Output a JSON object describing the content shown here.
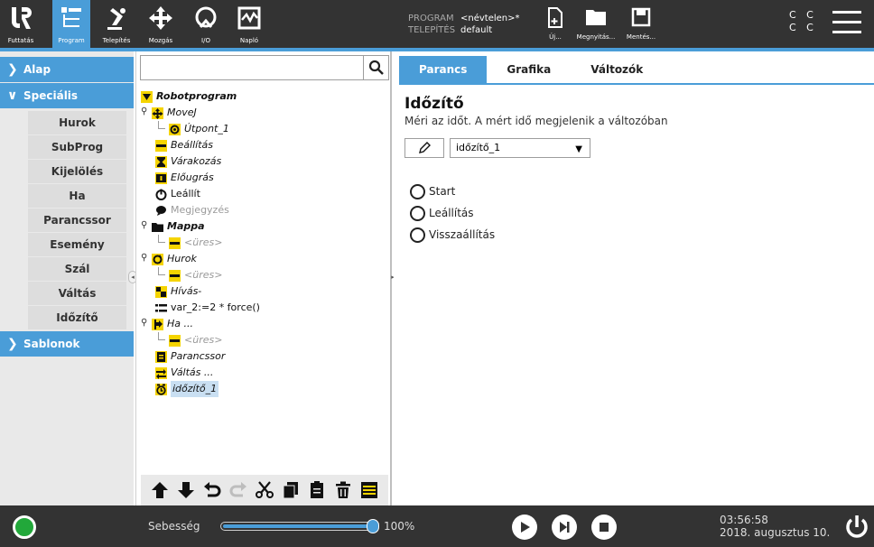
{
  "header": {
    "nav": [
      {
        "label": "Futtatás",
        "icon": "ur-logo-icon"
      },
      {
        "label": "Program",
        "icon": "program-icon",
        "active": true
      },
      {
        "label": "Telepítés",
        "icon": "installation-icon"
      },
      {
        "label": "Mozgás",
        "icon": "move-icon"
      },
      {
        "label": "I/O",
        "icon": "io-icon"
      },
      {
        "label": "Napló",
        "icon": "log-icon"
      }
    ],
    "program_key": "PROGRAM",
    "program_value": "<névtelen>*",
    "install_key": "TELEPÍTÉS",
    "install_value": "default",
    "file_buttons": [
      {
        "label": "Új...",
        "icon": "new-file-icon"
      },
      {
        "label": "Megnyitás...",
        "icon": "open-folder-icon"
      },
      {
        "label": "Mentés...",
        "icon": "save-icon"
      }
    ],
    "cc_row1": "C C",
    "cc_row2": "C C",
    "accent": "#4a9dd8"
  },
  "leftnav": {
    "alap": "Alap",
    "specialis": "Speciális",
    "items": [
      "Hurok",
      "SubProg",
      "Kijelölés",
      "Ha",
      "Parancssor",
      "Esemény",
      "Szál",
      "Váltás",
      "Időzítő"
    ],
    "sablonok": "Sablonok"
  },
  "tree": {
    "search_placeholder": "",
    "rows": [
      {
        "text": "Robotprogram",
        "icon": "triangle-down-icon",
        "style": "bold"
      },
      {
        "text": "MoveJ",
        "icon": "movej-icon",
        "style": "it"
      },
      {
        "text": "Útpont_1",
        "icon": "waypoint-icon",
        "style": "it"
      },
      {
        "text": "Beállítás",
        "icon": "set-icon",
        "style": "it"
      },
      {
        "text": "Várakozás",
        "icon": "hourglass-icon",
        "style": "it"
      },
      {
        "text": "Előugrás",
        "icon": "popup-icon",
        "style": "it"
      },
      {
        "text": "Leállít",
        "icon": "halt-icon",
        "style": ""
      },
      {
        "text": "Megjegyzés",
        "icon": "comment-icon",
        "style": "gray"
      },
      {
        "text": "Mappa",
        "icon": "folder-icon",
        "style": "bold"
      },
      {
        "text": "<üres>",
        "icon": "empty-icon",
        "style": "gray it"
      },
      {
        "text": "Hurok",
        "icon": "loop-icon",
        "style": "it"
      },
      {
        "text": "<üres>",
        "icon": "empty-icon",
        "style": "gray it"
      },
      {
        "text": "Hívás-",
        "icon": "call-icon",
        "style": "it"
      },
      {
        "text": "var_2:=2 * force()",
        "icon": "assignment-icon",
        "style": ""
      },
      {
        "text": "Ha ...",
        "icon": "if-icon",
        "style": "it"
      },
      {
        "text": "<üres>",
        "icon": "empty-icon",
        "style": "gray it"
      },
      {
        "text": "Parancssor",
        "icon": "script-icon",
        "style": "it"
      },
      {
        "text": "Váltás ...",
        "icon": "switch-icon",
        "style": "it"
      },
      {
        "text": "időzítő_1",
        "icon": "timer-icon",
        "style": "it",
        "selected": true
      }
    ]
  },
  "right": {
    "tabs": [
      "Parancs",
      "Grafika",
      "Változók"
    ],
    "title": "Időzítő",
    "description": "Méri az időt. A mért idő megjelenik a változóban",
    "variable": "időzítő_1",
    "options": [
      "Start",
      "Leállítás",
      "Visszaállítás"
    ]
  },
  "footer": {
    "speed_label": "Sebesség",
    "speed_value": "100%",
    "speed_fraction": 1.0,
    "time": "03:56:58",
    "date": "2018. augusztus 10.",
    "status_color": "#22a83a"
  }
}
